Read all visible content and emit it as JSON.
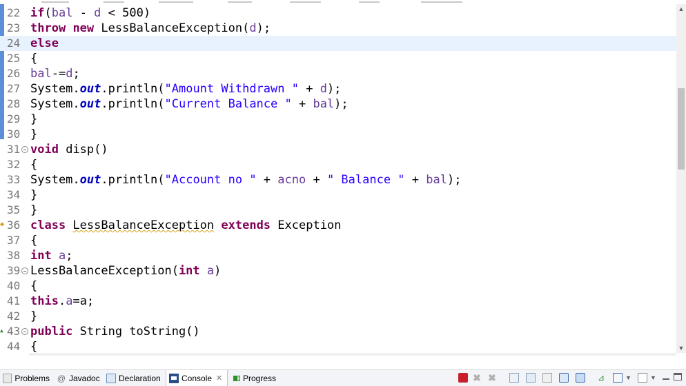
{
  "editor": {
    "lines": [
      {
        "n": "22",
        "code": [
          [
            "kw",
            "if"
          ],
          [
            "p",
            "("
          ],
          [
            "var",
            "bal"
          ],
          [
            "p",
            " - "
          ],
          [
            "var",
            "d"
          ],
          [
            "p",
            " < 500)"
          ]
        ]
      },
      {
        "n": "23",
        "code": [
          [
            "kw",
            "throw"
          ],
          [
            "p",
            " "
          ],
          [
            "kw",
            "new"
          ],
          [
            "p",
            " LessBalanceException("
          ],
          [
            "var",
            "d"
          ],
          [
            "p",
            ");"
          ]
        ]
      },
      {
        "n": "24",
        "code": [
          [
            "kw",
            "else"
          ]
        ],
        "current": true
      },
      {
        "n": "25",
        "code": [
          [
            "p",
            "{"
          ]
        ]
      },
      {
        "n": "26",
        "code": [
          [
            "var",
            "bal"
          ],
          [
            "p",
            "-="
          ],
          [
            "var",
            "d"
          ],
          [
            "p",
            ";"
          ]
        ]
      },
      {
        "n": "27",
        "code": [
          [
            "p",
            "System."
          ],
          [
            "fld",
            "out"
          ],
          [
            "p",
            ".println("
          ],
          [
            "str",
            "\"Amount Withdrawn \""
          ],
          [
            "p",
            " + "
          ],
          [
            "var",
            "d"
          ],
          [
            "p",
            ");"
          ]
        ]
      },
      {
        "n": "28",
        "code": [
          [
            "p",
            "System."
          ],
          [
            "fld",
            "out"
          ],
          [
            "p",
            ".println("
          ],
          [
            "str",
            "\"Current Balance \""
          ],
          [
            "p",
            " + "
          ],
          [
            "var",
            "bal"
          ],
          [
            "p",
            ");"
          ]
        ]
      },
      {
        "n": "29",
        "code": [
          [
            "p",
            "}"
          ]
        ]
      },
      {
        "n": "30",
        "code": [
          [
            "p",
            "}"
          ]
        ]
      },
      {
        "n": "31",
        "fold": true,
        "code": [
          [
            "kw",
            "void"
          ],
          [
            "p",
            " disp()"
          ]
        ]
      },
      {
        "n": "32",
        "code": [
          [
            "p",
            "{"
          ]
        ]
      },
      {
        "n": "33",
        "code": [
          [
            "p",
            "System."
          ],
          [
            "fld",
            "out"
          ],
          [
            "p",
            ".println("
          ],
          [
            "str",
            "\"Account no \""
          ],
          [
            "p",
            " + "
          ],
          [
            "var",
            "acno"
          ],
          [
            "p",
            " + "
          ],
          [
            "str",
            "\" Balance \""
          ],
          [
            "p",
            " + "
          ],
          [
            "var",
            "bal"
          ],
          [
            "p",
            ");"
          ]
        ]
      },
      {
        "n": "34",
        "code": [
          [
            "p",
            "}"
          ]
        ]
      },
      {
        "n": "35",
        "code": [
          [
            "p",
            "}"
          ]
        ]
      },
      {
        "n": "36",
        "marker": "warning",
        "code": [
          [
            "kw",
            "class"
          ],
          [
            "p",
            " "
          ],
          [
            "warn",
            "LessBalanceException"
          ],
          [
            "p",
            " "
          ],
          [
            "kw",
            "extends"
          ],
          [
            "p",
            " Exception"
          ]
        ]
      },
      {
        "n": "37",
        "code": [
          [
            "p",
            "{"
          ]
        ]
      },
      {
        "n": "38",
        "code": [
          [
            "kw",
            "int"
          ],
          [
            "p",
            " "
          ],
          [
            "var",
            "a"
          ],
          [
            "p",
            ";"
          ]
        ]
      },
      {
        "n": "39",
        "fold": true,
        "code": [
          [
            "p",
            "LessBalanceException("
          ],
          [
            "kw",
            "int"
          ],
          [
            "p",
            " "
          ],
          [
            "var",
            "a"
          ],
          [
            "p",
            ")"
          ]
        ]
      },
      {
        "n": "40",
        "code": [
          [
            "p",
            "{"
          ]
        ]
      },
      {
        "n": "41",
        "code": [
          [
            "kw",
            "this"
          ],
          [
            "p",
            "."
          ],
          [
            "var",
            "a"
          ],
          [
            "p",
            "=a;"
          ]
        ]
      },
      {
        "n": "42",
        "code": [
          [
            "p",
            "}"
          ]
        ]
      },
      {
        "n": "43",
        "fold": true,
        "marker": "override",
        "code": [
          [
            "kw",
            "public"
          ],
          [
            "p",
            " String toString()"
          ]
        ]
      },
      {
        "n": "44",
        "code": [
          [
            "p",
            "{"
          ]
        ]
      }
    ]
  },
  "bottom_tabs": [
    {
      "id": "problems",
      "label": "Problems",
      "icon": "problems-icon"
    },
    {
      "id": "javadoc",
      "label": "Javadoc",
      "icon": "at-icon"
    },
    {
      "id": "declaration",
      "label": "Declaration",
      "icon": "declaration-icon"
    },
    {
      "id": "console",
      "label": "Console",
      "icon": "console-icon",
      "active": true,
      "close": "✕"
    },
    {
      "id": "progress",
      "label": "Progress",
      "icon": "progress-icon"
    }
  ],
  "colors": {
    "keyword": "#7f0055",
    "string": "#2a00ff",
    "field": "#0000c0",
    "current_line": "#e8f2fe",
    "change_bar": "#5b8fd8"
  }
}
